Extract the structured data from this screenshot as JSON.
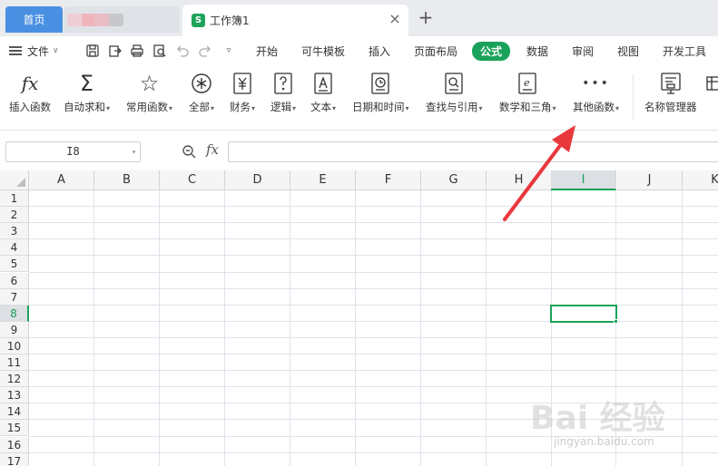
{
  "tabbar": {
    "home_label": "首页",
    "doc_title": "工作簿1",
    "doc_icon_letter": "S",
    "close_icon": "close-icon",
    "add_icon": "plus-icon"
  },
  "menubar": {
    "file_label": "文件",
    "tabs": [
      "开始",
      "可牛模板",
      "插入",
      "页面布局",
      "公式",
      "数据",
      "审阅",
      "视图",
      "开发工具"
    ],
    "active_tab": "公式",
    "accent": "#1aa25a"
  },
  "ribbon": {
    "buttons": [
      {
        "label": "插入函数",
        "icon": "fx-icon",
        "dropdown": false
      },
      {
        "label": "自动求和",
        "icon": "sigma-icon",
        "dropdown": true
      },
      {
        "label": "常用函数",
        "icon": "star-icon",
        "dropdown": true
      },
      {
        "label": "全部",
        "icon": "asterisk-icon",
        "dropdown": true
      },
      {
        "label": "财务",
        "icon": "yen-icon",
        "dropdown": true
      },
      {
        "label": "逻辑",
        "icon": "question-icon",
        "dropdown": true
      },
      {
        "label": "文本",
        "icon": "text-a-icon",
        "dropdown": true
      },
      {
        "label": "日期和时间",
        "icon": "clock-icon",
        "dropdown": true
      },
      {
        "label": "查找与引用",
        "icon": "search-icon",
        "dropdown": true
      },
      {
        "label": "数学和三角",
        "icon": "math-e-icon",
        "dropdown": true
      },
      {
        "label": "其他函数",
        "icon": "more-icon",
        "dropdown": true
      },
      {
        "label": "名称管理器",
        "icon": "name-manager-icon",
        "dropdown": false
      }
    ]
  },
  "formula_bar": {
    "cell_ref": "I8",
    "fx_label": "fx",
    "formula": ""
  },
  "grid": {
    "columns": [
      "A",
      "B",
      "C",
      "D",
      "E",
      "F",
      "G",
      "H",
      "I",
      "J",
      "K"
    ],
    "rows": [
      "1",
      "2",
      "3",
      "4",
      "5",
      "6",
      "7",
      "8",
      "9",
      "10",
      "11",
      "12",
      "13",
      "14",
      "15",
      "16",
      "17"
    ],
    "selected_column": "I",
    "selected_row": "8"
  },
  "watermark": {
    "text": "Bai 经验",
    "url_text": "jingyan.baidu.com"
  }
}
